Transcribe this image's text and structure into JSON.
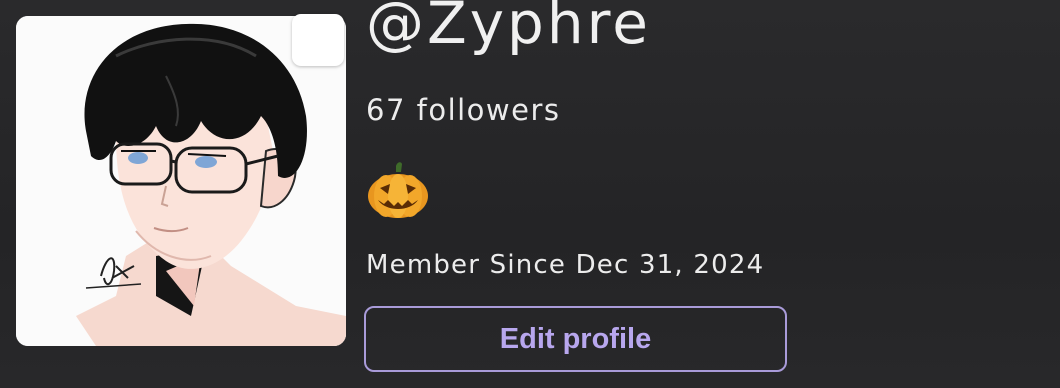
{
  "profile": {
    "username": "@Zyphre",
    "followers_text": "67 followers",
    "badge_icon": "jack-o-lantern-icon",
    "member_since_text": "Member Since Dec 31, 2024",
    "edit_button_label": "Edit profile"
  },
  "colors": {
    "background": "#252527",
    "text": "#ececec",
    "accent": "#b8a7ee",
    "accent_border": "#a99bd9"
  }
}
